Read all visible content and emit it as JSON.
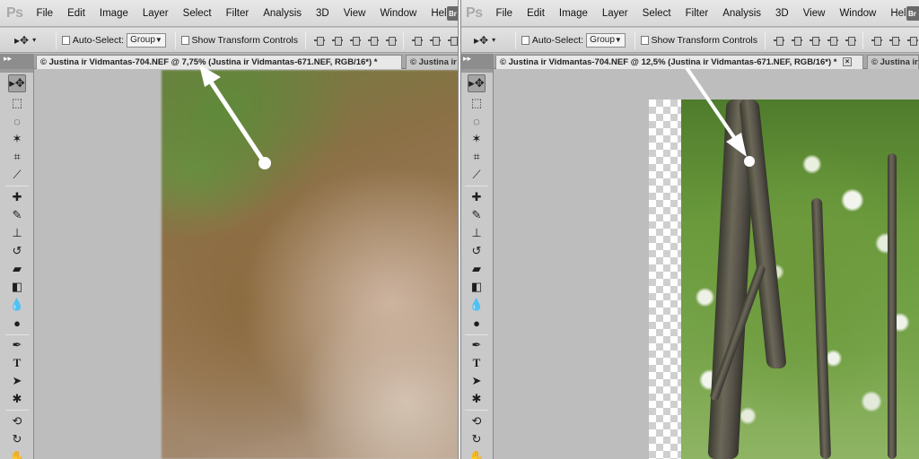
{
  "left": {
    "logo": "Ps",
    "menu": [
      "File",
      "Edit",
      "Image",
      "Layer",
      "Select",
      "Filter",
      "Analysis",
      "3D",
      "View",
      "Window",
      "Help"
    ],
    "bridge_label": "Br",
    "options": {
      "auto_select_label": "Auto-Select:",
      "auto_select_value": "Group",
      "show_transform_label": "Show Transform Controls"
    },
    "tabs": {
      "active_label": "© Justina ir Vidmantas-704.NEF @ 7,75% (Justina ir Vidmantas-671.NEF, RGB/16*)",
      "active_modified": "*",
      "inactive_label": "© Justina ir"
    }
  },
  "right": {
    "logo": "Ps",
    "menu": [
      "File",
      "Edit",
      "Image",
      "Layer",
      "Select",
      "Filter",
      "Analysis",
      "3D",
      "View",
      "Window",
      "Help"
    ],
    "bridge_label": "Br",
    "options": {
      "auto_select_label": "Auto-Select:",
      "auto_select_value": "Group",
      "show_transform_label": "Show Transform Controls"
    },
    "tabs": {
      "active_label": "© Justina ir Vidmantas-704.NEF @ 12,5% (Justina ir Vidmantas-671.NEF, RGB/16*)",
      "active_modified": "*",
      "close_glyph": "×",
      "inactive_label": "© Justina ir"
    }
  },
  "panel_grip": "▸▸",
  "toolbox_tools": [
    "move-tool-icon",
    "marquee-tool-icon",
    "lasso-tool-icon",
    "quick-select-tool-icon",
    "crop-tool-icon",
    "eyedropper-tool-icon",
    "healing-brush-tool-icon",
    "brush-tool-icon",
    "clone-stamp-tool-icon",
    "history-brush-tool-icon",
    "eraser-tool-icon",
    "paint-bucket-tool-icon",
    "blur-tool-icon",
    "dodge-tool-icon",
    "pen-tool-icon",
    "type-tool-icon",
    "path-select-tool-icon",
    "shape-tool-icon",
    "3d-rotate-tool-icon",
    "3d-orbit-tool-icon",
    "hand-tool-icon"
  ],
  "colors": {
    "menubar": "#dcdcdc",
    "workspace": "#bdbdbd",
    "arrow": "#ffffff"
  }
}
